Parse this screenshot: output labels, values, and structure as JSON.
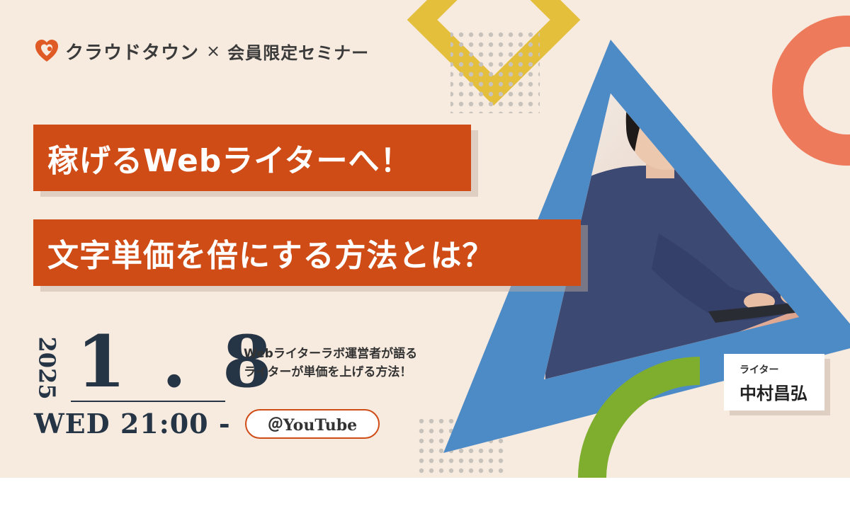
{
  "brand": {
    "name": "クラウドタウン",
    "cross": "×",
    "seminar": "会員限定セミナー",
    "logo_icon": "heart-logo-icon"
  },
  "title": {
    "line1": "稼げるWebライターへ！",
    "line2": "文字単価を倍にする方法とは？"
  },
  "event": {
    "year": "2025",
    "date": "1 . 8",
    "weekday_time": "WED 21:00 -",
    "description_line1": "Webライターラボ運営者が語る",
    "description_line2": "ライターが単価を上げる方法！",
    "venue": "＠YouTube"
  },
  "speaker": {
    "role": "ライター",
    "name": "中村昌弘"
  },
  "colors": {
    "background": "#f7eadf",
    "accent_orange": "#cf4c17",
    "navy": "#263545",
    "triangle_blue": "#4d8bc6",
    "ring_coral": "#ee7a5c",
    "diamond_yellow": "#e4bf3c",
    "arc_green": "#7fae2f",
    "dots_gray": "#c8c2bc"
  }
}
